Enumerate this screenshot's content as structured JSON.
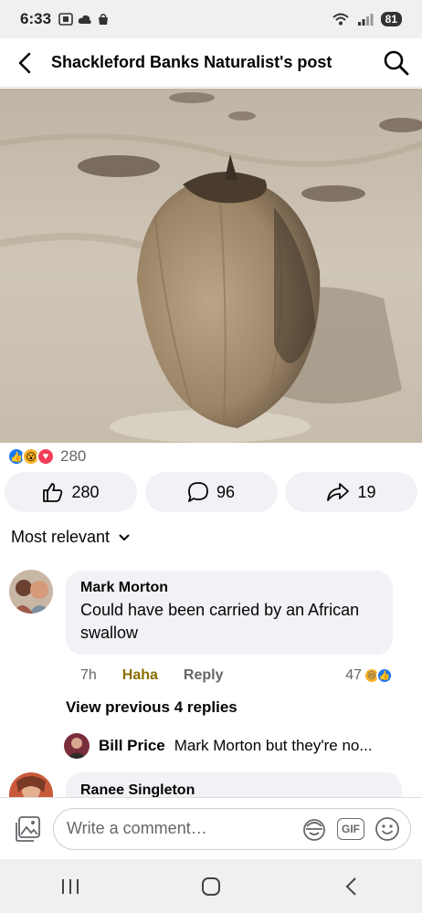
{
  "status_bar": {
    "time": "6:33",
    "battery": "81"
  },
  "header": {
    "title": "Shackleford Banks Naturalist's post"
  },
  "post": {
    "reaction_total": "280",
    "actions": {
      "like_count": "280",
      "comment_count": "96",
      "share_count": "19"
    }
  },
  "comments": {
    "sort_label": "Most relevant",
    "items": [
      {
        "author": "Mark Morton",
        "text": "Could have been carried by an African swallow",
        "time": "7h",
        "haha_label": "Haha",
        "reply_label": "Reply",
        "reaction_count": "47"
      },
      {
        "author": "Ranee Singleton"
      }
    ],
    "view_previous_replies": "View previous 4 replies",
    "reply": {
      "author": "Bill Price",
      "text": "Mark Morton but they're no..."
    }
  },
  "composer": {
    "placeholder": "Write a comment…",
    "gif_label": "GIF"
  },
  "colors": {
    "accent": "#1877f2",
    "bubble": "#f0f2f5",
    "haha": "#8a6d00",
    "love": "#f33e58"
  }
}
